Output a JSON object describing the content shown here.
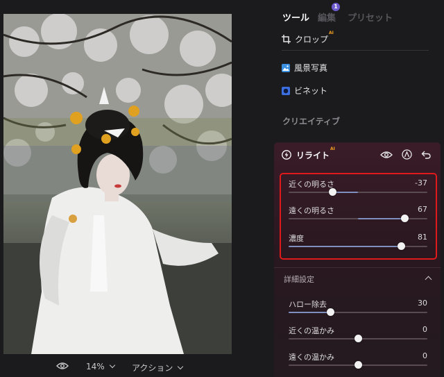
{
  "tabs": {
    "tools": "ツール",
    "edit": "編集",
    "edit_badge": "1",
    "presets": "プリセット"
  },
  "tools": {
    "crop": {
      "label": "クロップ",
      "ai": "AI"
    },
    "landscape": {
      "label": "風景写真",
      "color": "#3b8fe0"
    },
    "vignette": {
      "label": "ビネット",
      "color": "#3b6fe0"
    }
  },
  "creative_section": "クリエイティブ",
  "relight": {
    "title": "リライト",
    "ai": "AI",
    "sliders": [
      {
        "label": "近くの明るさ",
        "value": "-37",
        "level": -0.37,
        "bipolar": true
      },
      {
        "label": "遠くの明るさ",
        "value": "67",
        "level": 0.67,
        "bipolar": true
      },
      {
        "label": "濃度",
        "value": "81",
        "level": 0.81,
        "bipolar": false
      }
    ],
    "details_title": "詳細設定",
    "detail_sliders": [
      {
        "label": "ハロー除去",
        "value": "30",
        "level": 0.3,
        "bipolar": false
      },
      {
        "label": "近くの温かみ",
        "value": "0",
        "level": 0,
        "bipolar": true
      },
      {
        "label": "遠くの温かみ",
        "value": "0",
        "level": 0,
        "bipolar": true
      }
    ]
  },
  "bottom_bar": {
    "zoom": "14%",
    "action": "アクション"
  },
  "colors": {
    "accent": "#6d5bd0",
    "highlight": "#e01a1a",
    "ai_tag": "#f0a020"
  }
}
